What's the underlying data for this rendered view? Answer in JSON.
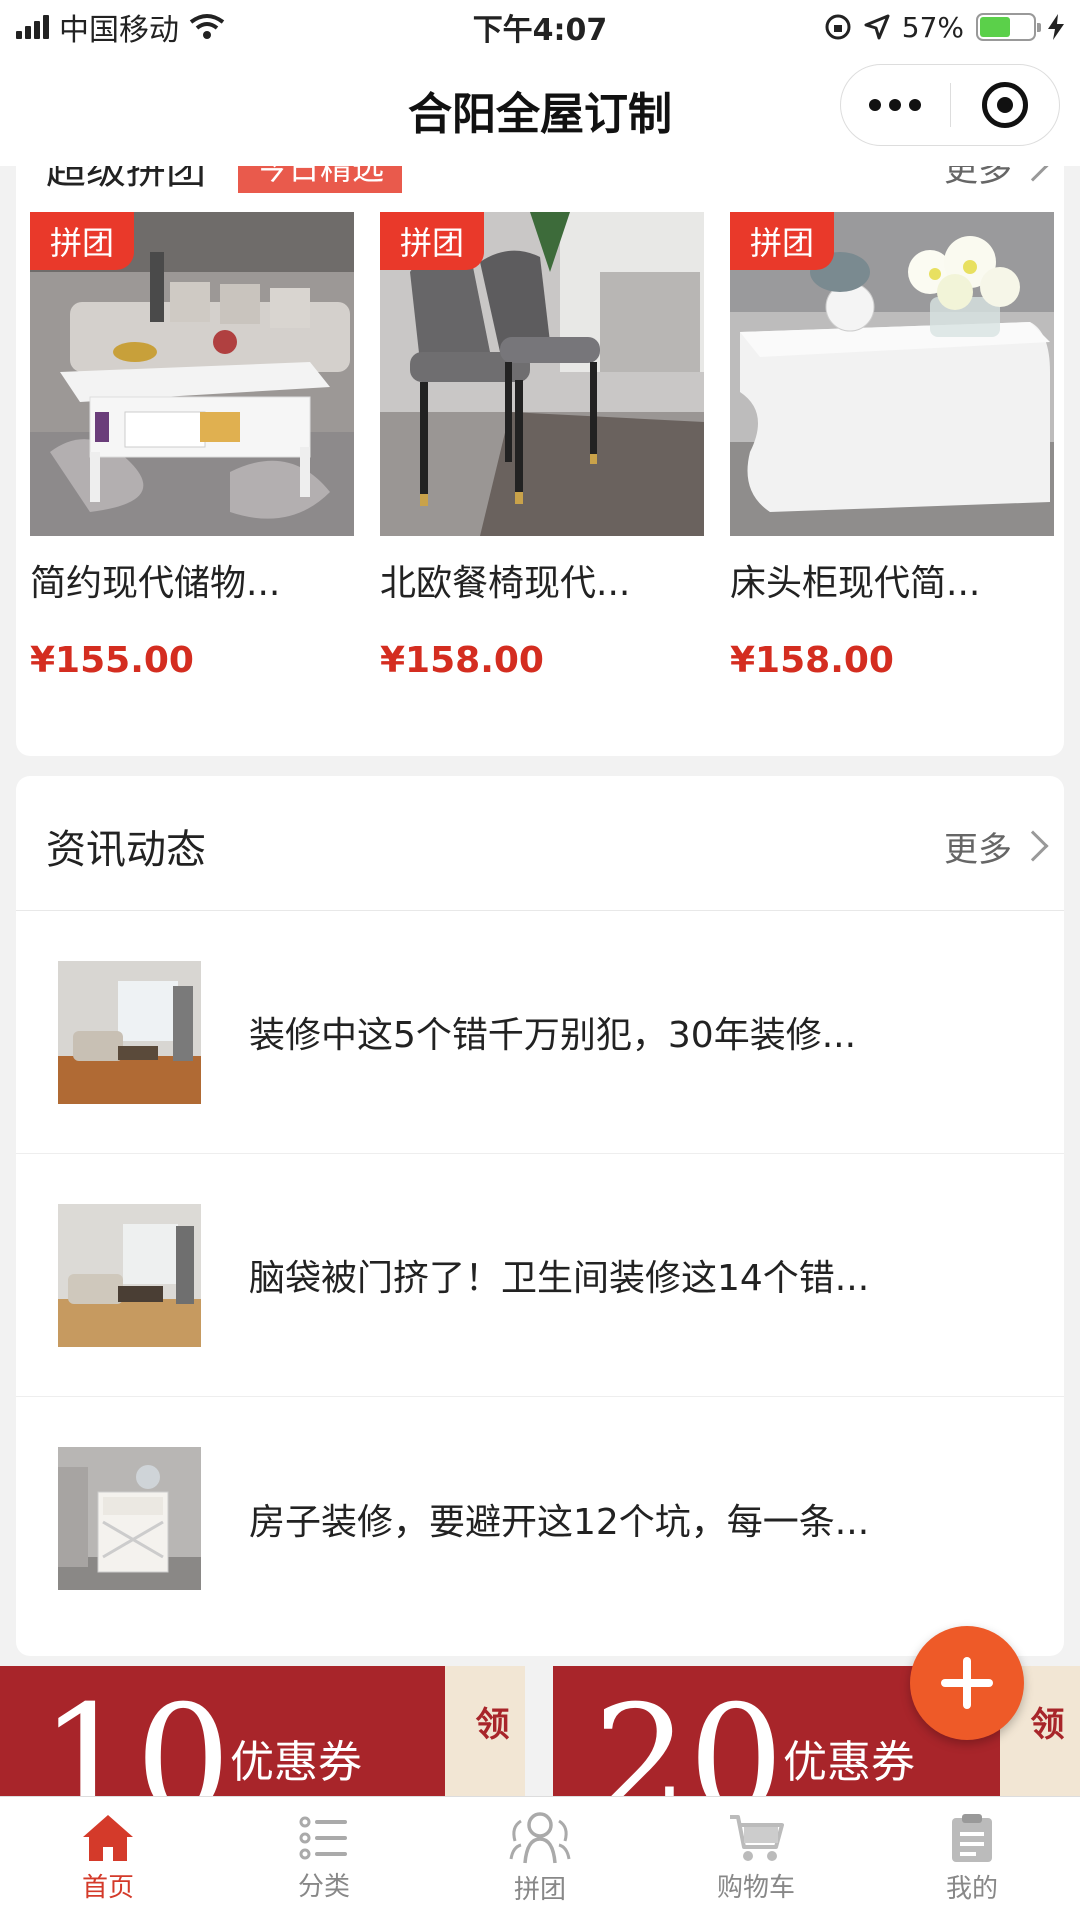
{
  "status_bar": {
    "carrier": "中国移动",
    "time": "下午4:07",
    "battery": "57%",
    "battery_level": 0.57
  },
  "nav": {
    "title": "合阳全屋订制"
  },
  "group_buy": {
    "title": "超级拼团",
    "tag": "今日精选",
    "more": "更多",
    "products": [
      {
        "badge": "拼团",
        "name": "简约现代储物...",
        "price": "¥155.00"
      },
      {
        "badge": "拼团",
        "name": "北欧餐椅现代...",
        "price": "¥158.00"
      },
      {
        "badge": "拼团",
        "name": "床头柜现代简...",
        "price": "¥158.00"
      }
    ]
  },
  "news": {
    "title": "资讯动态",
    "more": "更多",
    "items": [
      {
        "text": "装修中这5个错千万别犯，30年装修..."
      },
      {
        "text": "脑袋被门挤了！卫生间装修这14个错..."
      },
      {
        "text": "房子装修，要避开这12个坑，每一条..."
      }
    ]
  },
  "coupons": [
    {
      "amount": "10",
      "label": "优惠券",
      "action": "点击领"
    },
    {
      "amount": "20",
      "label": "优惠券",
      "action": "点击领"
    }
  ],
  "tabs": [
    {
      "label": "首页",
      "icon": "home-icon",
      "active": true
    },
    {
      "label": "分类",
      "icon": "category-list-icon",
      "active": false
    },
    {
      "label": "拼团",
      "icon": "group-people-icon",
      "active": false
    },
    {
      "label": "购物车",
      "icon": "cart-icon",
      "active": false
    },
    {
      "label": "我的",
      "icon": "clipboard-icon",
      "active": false
    }
  ],
  "colors": {
    "accent_red": "#d42d20",
    "tag_red": "#e95a4c",
    "fab_orange": "#ee5a28",
    "tab_active": "#d43a2a",
    "coupon_red": "#a8252a"
  }
}
